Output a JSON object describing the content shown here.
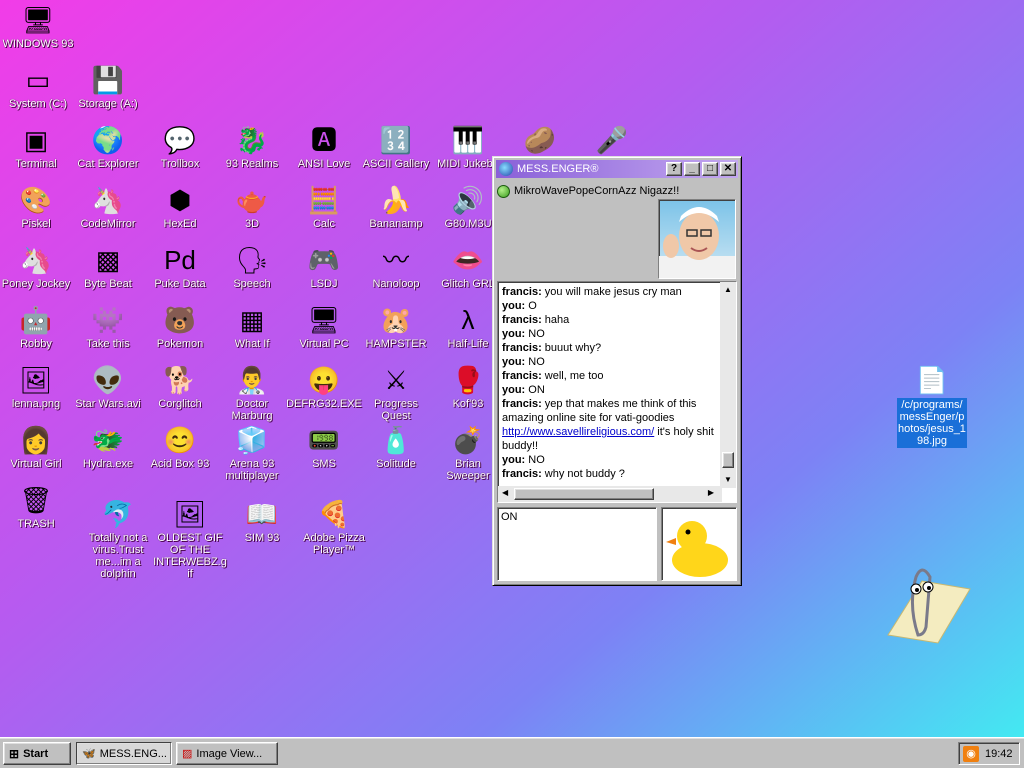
{
  "desktop": {
    "icons": [
      {
        "label": "WINDOWS 93",
        "glyph": "🖥"
      },
      {
        "label": "System (C:)",
        "glyph": "▭"
      },
      {
        "label": "Storage (A:)",
        "glyph": "💾"
      },
      {
        "label": "Terminal",
        "glyph": "▣"
      },
      {
        "label": "Cat Explorer",
        "glyph": "🌍"
      },
      {
        "label": "Trollbox",
        "glyph": "💬"
      },
      {
        "label": "93 Realms",
        "glyph": "🐉"
      },
      {
        "label": "ANSI Love",
        "glyph": "🅰"
      },
      {
        "label": "ASCII Gallery",
        "glyph": "🔢"
      },
      {
        "label": "MIDI Jukebo",
        "glyph": "🎹"
      },
      {
        "label": "",
        "glyph": "🥔"
      },
      {
        "label": "",
        "glyph": "🎤"
      },
      {
        "label": "Piskel",
        "glyph": "🎨"
      },
      {
        "label": "CodeMirror",
        "glyph": "🦄"
      },
      {
        "label": "HexEd",
        "glyph": "⬢"
      },
      {
        "label": "3D",
        "glyph": "🫖"
      },
      {
        "label": "Calc",
        "glyph": "🧮"
      },
      {
        "label": "Bananamp",
        "glyph": "🍌"
      },
      {
        "label": "G80.M3U",
        "glyph": "🔊"
      },
      {
        "label": "Poney Jockey",
        "glyph": "🦄"
      },
      {
        "label": "Byte Beat",
        "glyph": "▩"
      },
      {
        "label": "Puke Data",
        "glyph": "Pd"
      },
      {
        "label": "Speech",
        "glyph": "🗣"
      },
      {
        "label": "LSDJ",
        "glyph": "🎮"
      },
      {
        "label": "Nanoloop",
        "glyph": "〰"
      },
      {
        "label": "Glitch GRL",
        "glyph": "👄"
      },
      {
        "label": "Robby",
        "glyph": "🤖"
      },
      {
        "label": "Take this",
        "glyph": "👾"
      },
      {
        "label": "Pokemon",
        "glyph": "🐻"
      },
      {
        "label": "What If",
        "glyph": "▦"
      },
      {
        "label": "Virtual PC",
        "glyph": "🖥"
      },
      {
        "label": "HAMPSTER",
        "glyph": "🐹"
      },
      {
        "label": "Half-Life",
        "glyph": "λ"
      },
      {
        "label": "lenna.png",
        "glyph": "🖼"
      },
      {
        "label": "Star Wars.avi",
        "glyph": "👽"
      },
      {
        "label": "Corglitch",
        "glyph": "🐕"
      },
      {
        "label": "Doctor Marburg",
        "glyph": "👨‍⚕️"
      },
      {
        "label": "DEFRG32.EXE",
        "glyph": "😛"
      },
      {
        "label": "Progress Quest",
        "glyph": "⚔"
      },
      {
        "label": "Kof'93",
        "glyph": "🥊"
      },
      {
        "label": "Virtual Girl",
        "glyph": "👩"
      },
      {
        "label": "Hydra.exe",
        "glyph": "🐲"
      },
      {
        "label": "Acid Box 93",
        "glyph": "😊"
      },
      {
        "label": "Arena 93 multiplayer",
        "glyph": "🧊"
      },
      {
        "label": "SMS",
        "glyph": "📟"
      },
      {
        "label": "Solitude",
        "glyph": "🧴"
      },
      {
        "label": "Brian Sweeper",
        "glyph": "💣"
      },
      {
        "label": "TRASH",
        "glyph": "🗑"
      },
      {
        "label": "Totally not a virus.Trust me...im a dolphin",
        "glyph": "🐬"
      },
      {
        "label": "OLDEST GIF OF THE INTERWEBZ.gif",
        "glyph": "🖼"
      },
      {
        "label": "SIM 93",
        "glyph": "📖"
      },
      {
        "label": "Adobe Pizza Player™",
        "glyph": "🍕"
      },
      {
        "label": "/c/programs/messEnger/photos/jesus_198.jpg",
        "glyph": "📄"
      }
    ]
  },
  "messenger": {
    "title": "MESS.ENGER®",
    "buttons": {
      "help": "?",
      "minimize": "_",
      "maximize": "□",
      "close": "✕"
    },
    "contact": "MikroWavePopeCornAzz Nigazz!!",
    "log": [
      {
        "who": "francis:",
        "text": " you will make jesus cry man"
      },
      {
        "who": "you:",
        "text": " O"
      },
      {
        "who": "francis:",
        "text": " haha"
      },
      {
        "who": "you:",
        "text": " NO"
      },
      {
        "who": "francis:",
        "text": " buuut why?"
      },
      {
        "who": "you:",
        "text": " NO"
      },
      {
        "who": "francis:",
        "text": " well, me too"
      },
      {
        "who": "you:",
        "text": " ON"
      },
      {
        "who": "francis:",
        "text": " yep that makes me think of this amazing online site for vati-goodies "
      },
      {
        "who": "you:",
        "text": " NO"
      },
      {
        "who": "francis:",
        "text": " why not buddy ?"
      }
    ],
    "link": "http://www.savellireligious.com/",
    "link_after": " it's holy shit buddy!!",
    "input_value": "ON"
  },
  "taskbar": {
    "start": "Start",
    "tasks": [
      "MESS.ENG...",
      "Image View..."
    ],
    "clock": "19:42"
  }
}
